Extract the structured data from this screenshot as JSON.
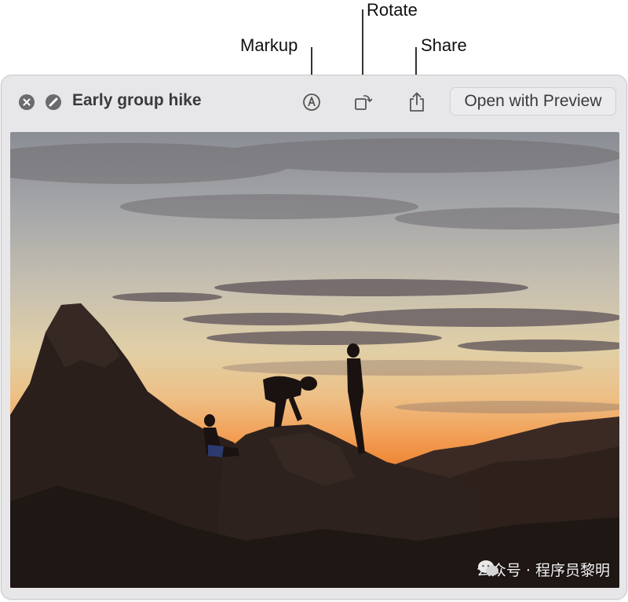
{
  "callouts": {
    "markup": "Markup",
    "rotate": "Rotate",
    "share": "Share"
  },
  "window": {
    "title": "Early group hike",
    "open_button_label": "Open with Preview",
    "icons": [
      "close-icon",
      "full-screen-icon",
      "markup-icon",
      "rotate-icon",
      "share-icon"
    ]
  },
  "photo": {
    "subject": "Silhouettes of hikers on rocks at sunset"
  },
  "watermark": {
    "text": "公众号 · 程序员黎明"
  }
}
